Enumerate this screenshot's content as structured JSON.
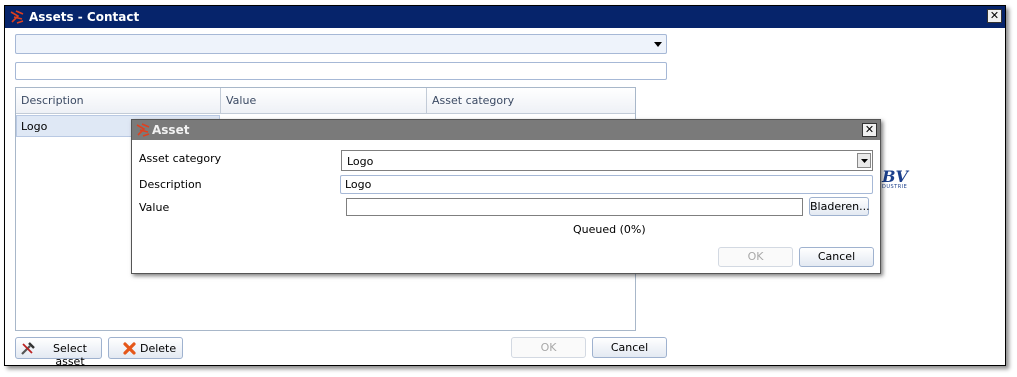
{
  "window": {
    "title": "Assets - Contact"
  },
  "filter": {
    "combo_value": "",
    "search_value": ""
  },
  "grid": {
    "columns": [
      "Description",
      "Value",
      "Asset category"
    ],
    "rows": [
      {
        "description": "Logo",
        "value": "",
        "category": ""
      }
    ]
  },
  "footer": {
    "select_label": "Select asset",
    "delete_label": "Delete",
    "ok_label": "OK",
    "cancel_label": "Cancel"
  },
  "dialog": {
    "title": "Asset",
    "category_label": "Asset category",
    "category_value": "Logo",
    "description_label": "Description",
    "description_value": "Logo",
    "value_label": "Value",
    "value_value": "",
    "browse_label": "Bladeren...",
    "status": "Queued (0%)",
    "ok_label": "OK",
    "cancel_label": "Cancel"
  },
  "background_logo": {
    "text": "BV",
    "subtext": "DUSTRIE"
  },
  "colors": {
    "title_bar": "#06246b",
    "dialog_title_bar": "#7a7a7a",
    "selection": "#dfe8f5",
    "accent_icon": "#d03a1a"
  },
  "icons": {
    "app": "app-logo-icon",
    "close": "close-icon",
    "select": "tools-icon",
    "delete": "delete-x-icon",
    "dropdown": "chevron-down-icon"
  }
}
